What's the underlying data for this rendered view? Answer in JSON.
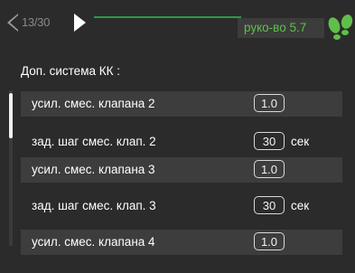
{
  "header": {
    "page_indicator": "13/30",
    "title": "руко-во 5.7",
    "logo_icon": "footprints-icon",
    "accent_color": "#5fbf4a"
  },
  "section": {
    "title": "Доп. система КК :"
  },
  "rows": [
    {
      "label": "усил. смес. клапана 2",
      "value": "1.0",
      "unit": ""
    },
    {
      "label": "зад. шаг смес. клап. 2",
      "value": "30",
      "unit": "сек"
    },
    {
      "label": "усил. смес. клапана 3",
      "value": "1.0",
      "unit": ""
    },
    {
      "label": "зад. шаг смес. клап. 3",
      "value": "30",
      "unit": "сек"
    },
    {
      "label": "усил. смес. клапана 4",
      "value": "1.0",
      "unit": ""
    }
  ]
}
